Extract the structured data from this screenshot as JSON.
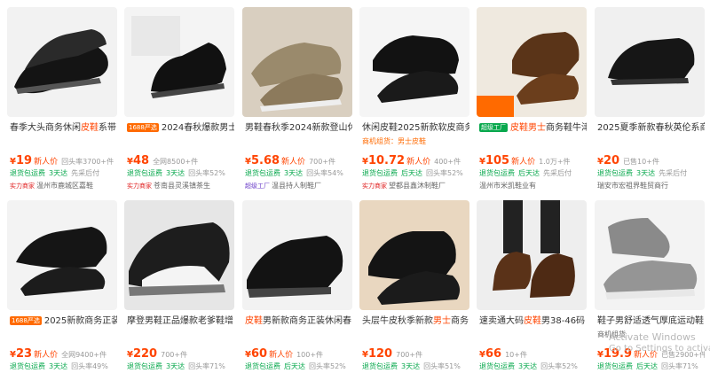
{
  "colors": {
    "price": "#ff4400",
    "ship": "#08a84d",
    "badge": "#ff6a00"
  },
  "products": [
    {
      "title_pre": "春季大头商务休闲",
      "title_hl": "皮鞋",
      "title_post": "系带",
      "tag": "",
      "subtitle": "",
      "price": "19",
      "newtag": "新人价",
      "sold": "回头率3700+件",
      "ship": "退货包运费",
      "ship_days": "3天达",
      "repeat": "先采后付",
      "shop_badge": "实力商家",
      "shop": "温州市鹿城区嘉鞋"
    },
    {
      "title_pre": "2024春秋爆款男士",
      "title_hl": "",
      "title_post": "",
      "tag": "1688严选",
      "subtitle": "",
      "price": "48",
      "newtag": "",
      "sold": "全网8500+件",
      "ship": "退货包运费",
      "ship_days": "3天达",
      "repeat": "回头率52%",
      "shop_badge": "实力商家",
      "shop": "苍南县灵溪镇茶生"
    },
    {
      "title_pre": "男鞋春秋季2024新款登山休",
      "title_hl": "",
      "title_post": "",
      "tag": "",
      "subtitle": "",
      "price": "5.68",
      "newtag": "新人价",
      "sold": "700+件",
      "ship": "退货包运费",
      "ship_days": "3天达",
      "repeat": "回头率54%",
      "shop_badge": "超级工厂",
      "shop": "温县持人制鞋厂"
    },
    {
      "title_pre": "休闲皮鞋2025新款软皮商务",
      "title_hl": "",
      "title_post": "",
      "tag": "",
      "subtitle": "商机组货：男士皮鞋",
      "price": "10.72",
      "newtag": "新人价",
      "sold": "400+件",
      "ship": "退货包运费",
      "ship_days": "后天达",
      "repeat": "回头率52%",
      "shop_badge": "实力商家",
      "shop": "望都县鑫沐制鞋厂"
    },
    {
      "title_pre": "",
      "title_hl": "皮鞋男士",
      "title_post": "商务鞋牛津",
      "tag": "超级工厂",
      "subtitle": "",
      "price": "105",
      "newtag": "新人价",
      "sold": "1.0万+件",
      "ship": "退货包运费",
      "ship_days": "后天达",
      "repeat": "先采后付",
      "shop_badge": "",
      "shop": "温州市米凯鞋业有"
    },
    {
      "title_pre": "2025夏季新款春秋英伦系商",
      "title_hl": "",
      "title_post": "",
      "tag": "",
      "subtitle": "",
      "price": "20",
      "newtag": "",
      "sold": "已售10+件",
      "ship": "退货包运费",
      "ship_days": "3天达",
      "repeat": "先采后付",
      "shop_badge": "",
      "shop": "瑞安市宏祖界鞋贸商行"
    },
    {
      "title_pre": "2025新款商务正装",
      "title_hl": "",
      "title_post": "",
      "tag": "1688严选",
      "subtitle": "",
      "price": "23",
      "newtag": "新人价",
      "sold": "全网9400+件",
      "ship": "退货包运费",
      "ship_days": "3天达",
      "repeat": "回头率49%",
      "shop_badge": "",
      "shop": ""
    },
    {
      "title_pre": "摩登男鞋正品爆款老爹鞋增",
      "title_hl": "",
      "title_post": "",
      "tag": "",
      "subtitle": "",
      "price": "220",
      "newtag": "",
      "sold": "700+件",
      "ship": "退货包运费",
      "ship_days": "3天达",
      "repeat": "回头率71%",
      "shop_badge": "",
      "shop": ""
    },
    {
      "title_pre": "",
      "title_hl": "皮鞋",
      "title_post": "男新款商务正装休闲春",
      "tag": "",
      "subtitle": "",
      "price": "60",
      "newtag": "新人价",
      "sold": "100+件",
      "ship": "退货包运费",
      "ship_days": "后天达",
      "repeat": "回头率52%",
      "shop_badge": "",
      "shop": ""
    },
    {
      "title_pre": "头层牛皮秋季新款",
      "title_hl": "男士",
      "title_post": "商务",
      "tag": "",
      "subtitle": "",
      "price": "120",
      "newtag": "",
      "sold": "700+件",
      "ship": "退货包运费",
      "ship_days": "3天达",
      "repeat": "回头率51%",
      "shop_badge": "",
      "shop": ""
    },
    {
      "title_pre": "速卖通大码",
      "title_hl": "皮鞋",
      "title_post": "男38-46码",
      "tag": "",
      "subtitle": "",
      "price": "66",
      "newtag": "",
      "sold": "10+件",
      "ship": "退货包运费",
      "ship_days": "3天达",
      "repeat": "回头率52%",
      "shop_badge": "",
      "shop": ""
    },
    {
      "title_pre": "鞋子男舒适透气厚底运动鞋",
      "title_hl": "",
      "title_post": "",
      "tag": "",
      "subtitle": "商机组货",
      "price": "19.9",
      "newtag": "新人价",
      "sold": "已售2900+件",
      "ship": "退货包运费",
      "ship_days": "后天达",
      "repeat": "回头率71%",
      "shop_badge": "",
      "shop": ""
    }
  ],
  "overlay": {
    "line1": "Activate Windows",
    "line2": "Go to Settings to activate"
  }
}
